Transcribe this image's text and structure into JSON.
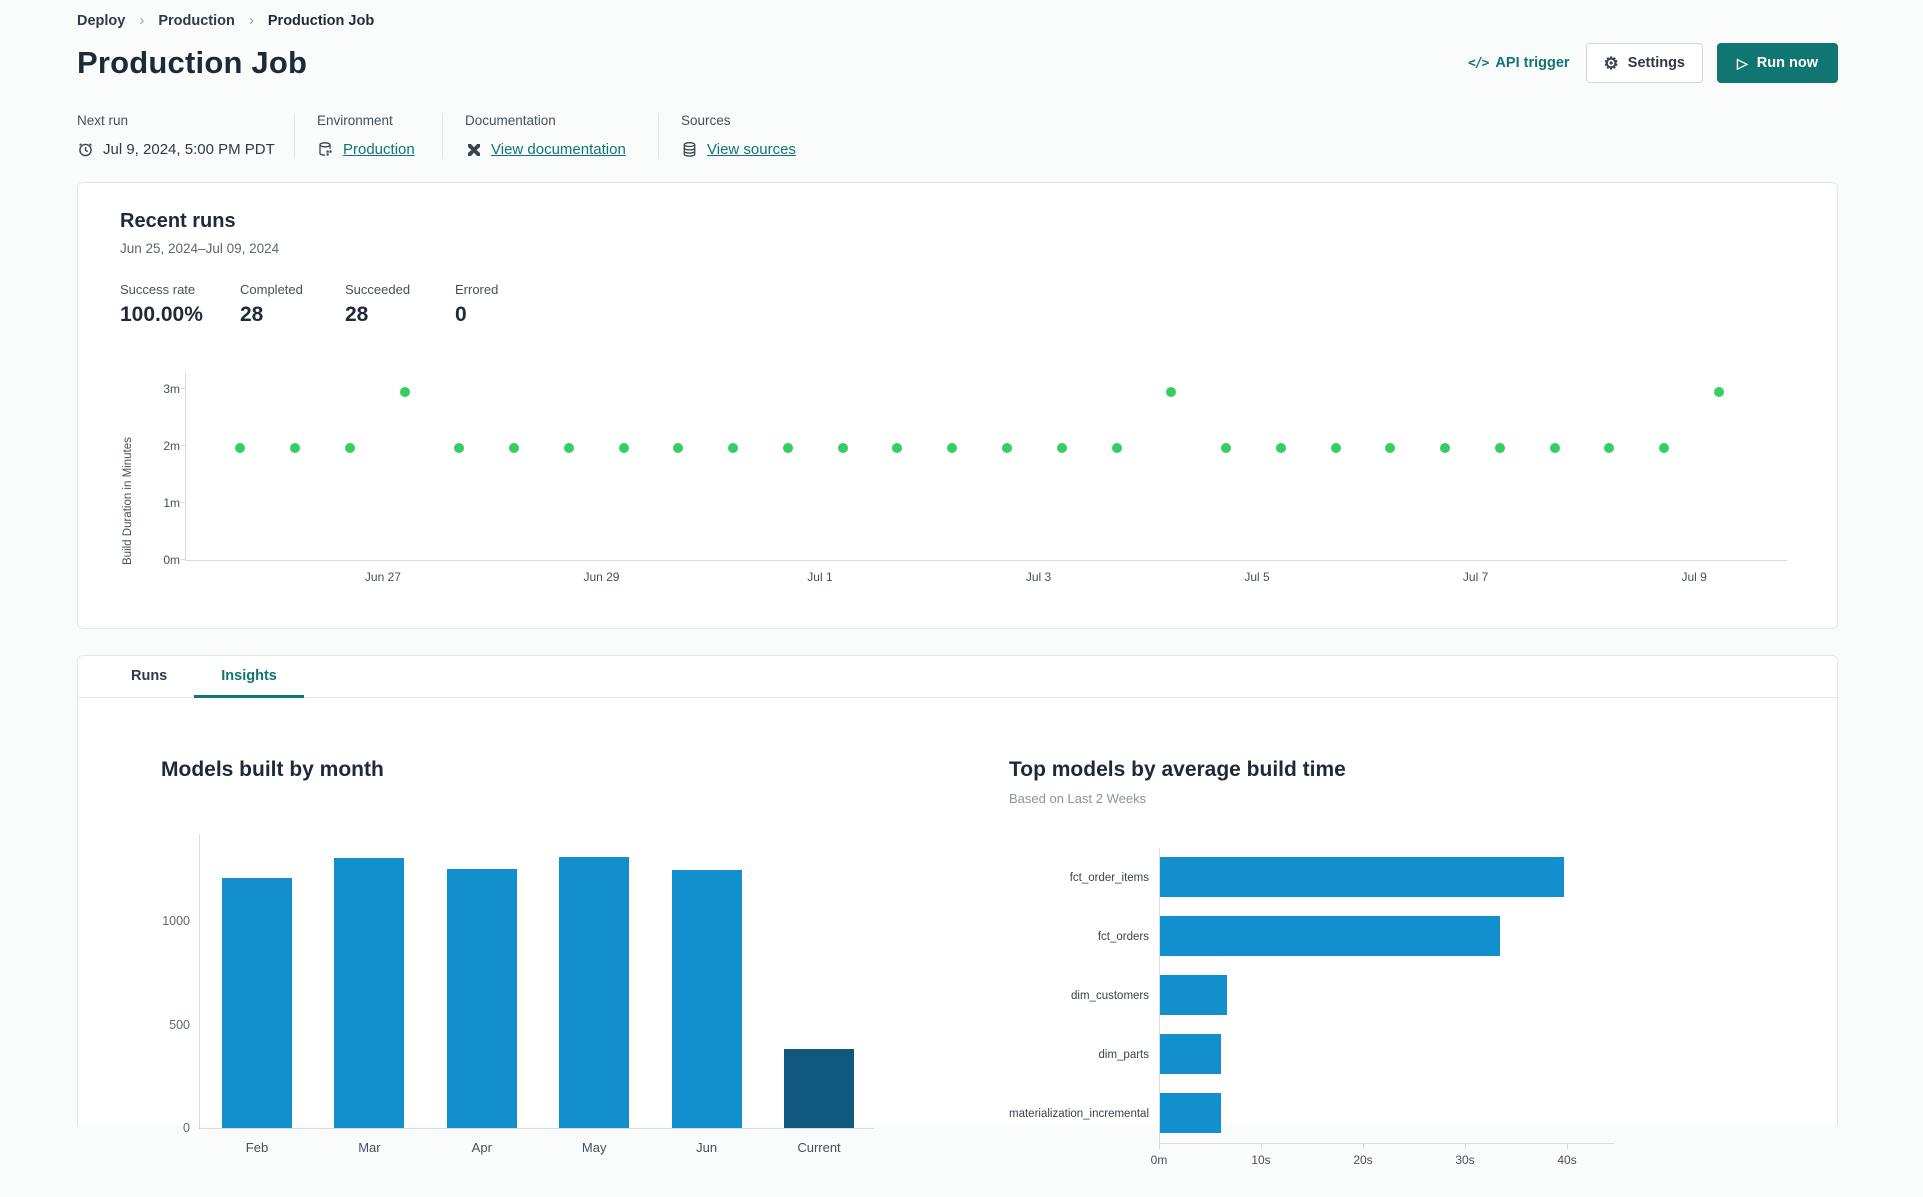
{
  "colors": {
    "accent_teal": "#107671",
    "success_green": "#33cf5f",
    "bar_blue": "#1290cd",
    "bar_dark_blue": "#11587e",
    "text_dark": "#1e2a38",
    "border": "#e4e7ea"
  },
  "breadcrumb": {
    "items": [
      {
        "label": "Deploy"
      },
      {
        "label": "Production"
      },
      {
        "label": "Production Job"
      }
    ]
  },
  "header": {
    "title": "Production Job",
    "api_trigger_label": "API trigger",
    "api_trigger_icon": "</>",
    "settings_label": "Settings",
    "run_now_label": "Run now"
  },
  "meta": {
    "next_run": {
      "label": "Next run",
      "value": "Jul 9, 2024, 5:00 PM PDT",
      "icon": "alarm-clock-icon"
    },
    "environment": {
      "label": "Environment",
      "value": "Production",
      "icon": "database-gear-icon"
    },
    "documentation": {
      "label": "Documentation",
      "value": "View documentation",
      "icon": "dbt-docs-icon"
    },
    "sources": {
      "label": "Sources",
      "value": "View sources",
      "icon": "database-stack-icon"
    }
  },
  "recent_runs": {
    "title": "Recent runs",
    "date_range": "Jun 25, 2024–Jul 09, 2024",
    "stats": [
      {
        "label": "Success rate",
        "value": "100.00%"
      },
      {
        "label": "Completed",
        "value": "28"
      },
      {
        "label": "Succeeded",
        "value": "28"
      },
      {
        "label": "Errored",
        "value": "0"
      }
    ]
  },
  "tabs": [
    {
      "label": "Runs",
      "active": false
    },
    {
      "label": "Insights",
      "active": true
    }
  ],
  "chart_data": [
    {
      "id": "run_durations",
      "type": "scatter",
      "title": "Recent runs",
      "ylabel": "Build Duration in Minutes",
      "yticks": [
        {
          "value": 0,
          "label": "0m"
        },
        {
          "value": 1,
          "label": "1m"
        },
        {
          "value": 2,
          "label": "2m"
        },
        {
          "value": 3,
          "label": "3m"
        }
      ],
      "ylim": [
        0,
        3.3
      ],
      "xticklabels": [
        "Jun 27",
        "Jun 29",
        "Jul 1",
        "Jul 3",
        "Jul 5",
        "Jul 7",
        "Jul 9"
      ],
      "values": [
        1.97,
        1.97,
        1.97,
        2.95,
        1.97,
        1.97,
        1.97,
        1.97,
        1.97,
        1.97,
        1.97,
        1.97,
        1.97,
        1.97,
        1.97,
        1.97,
        1.97,
        2.95,
        1.97,
        1.97,
        1.97,
        1.97,
        1.97,
        1.97,
        1.97,
        1.97,
        1.97,
        2.95
      ],
      "point_color": "#33cf5f",
      "legend": "none",
      "grid": false
    },
    {
      "id": "models_by_month",
      "type": "bar",
      "title": "Models built by month",
      "categories": [
        "Feb",
        "Mar",
        "Apr",
        "May",
        "Jun",
        "Current"
      ],
      "values": [
        1210,
        1305,
        1253,
        1310,
        1248,
        380
      ],
      "yticks": [
        0,
        500,
        1000
      ],
      "ylim": [
        0,
        1425
      ],
      "bar_color": "#1290cd",
      "highlight_index": 5,
      "highlight_color": "#11587e",
      "xlabel": "",
      "ylabel": "",
      "grid": false
    },
    {
      "id": "top_models",
      "type": "bar_h",
      "title": "Top models by average build time",
      "subtitle": "Based on Last 2 Weeks",
      "categories": [
        "fct_order_items",
        "fct_orders",
        "dim_customers",
        "dim_parts",
        "materialization_incremental"
      ],
      "values": [
        39.6,
        33.3,
        6.6,
        6.0,
        6.0
      ],
      "xticks": [
        {
          "value": 0,
          "label": "0m"
        },
        {
          "value": 10,
          "label": "10s"
        },
        {
          "value": 20,
          "label": "20s"
        },
        {
          "value": 30,
          "label": "30s"
        },
        {
          "value": 40,
          "label": "40s"
        }
      ],
      "xlim": [
        0,
        44.5
      ],
      "bar_color": "#1290cd",
      "grid": false
    }
  ]
}
